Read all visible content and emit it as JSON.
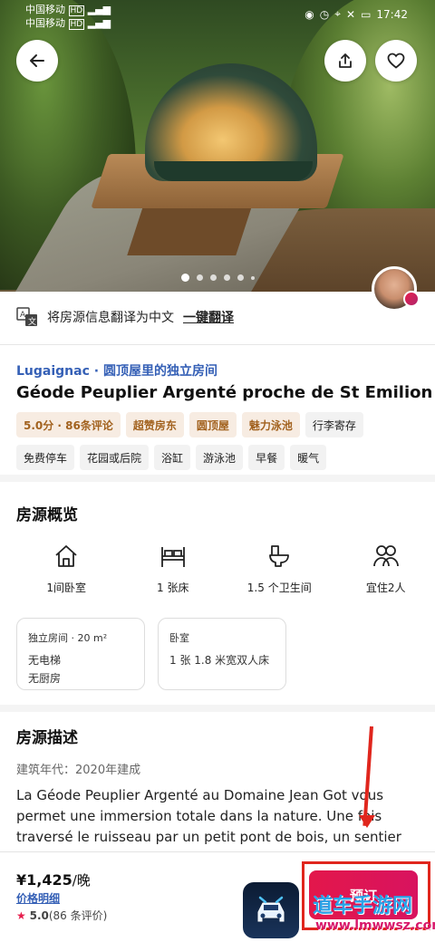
{
  "status_bar": {
    "carrier1": "中国移动",
    "carrier1_tag": "HD",
    "carrier2": "中国移动",
    "carrier2_tag": "HD",
    "time": "17:42"
  },
  "hero": {
    "slide_count": 5,
    "active_slide": 1
  },
  "translate": {
    "text": "将房源信息翻译为中文",
    "action": "一键翻译"
  },
  "listing": {
    "subtitle": "Lugaignac · 圆顶屋里的独立房间",
    "title": "Géode Peuplier Argenté proche de St Emilion",
    "tags": [
      {
        "label": "5.0分 · 86条评论",
        "highlight": true
      },
      {
        "label": "超赞房东",
        "highlight": true
      },
      {
        "label": "圆顶屋",
        "highlight": true
      },
      {
        "label": "魅力泳池",
        "highlight": true
      },
      {
        "label": "行李寄存",
        "highlight": false
      },
      {
        "label": "免费停车",
        "highlight": false
      },
      {
        "label": "花园或后院",
        "highlight": false
      },
      {
        "label": "浴缸",
        "highlight": false
      },
      {
        "label": "游泳池",
        "highlight": false
      },
      {
        "label": "早餐",
        "highlight": false
      },
      {
        "label": "暖气",
        "highlight": false
      }
    ]
  },
  "overview": {
    "title": "房源概览",
    "amenities": [
      {
        "label": "1间卧室",
        "icon": "house-icon"
      },
      {
        "label": "1 张床",
        "icon": "bed-icon"
      },
      {
        "label": "1.5 个卫生间",
        "icon": "toilet-icon"
      },
      {
        "label": "宜住2人",
        "icon": "people-icon"
      }
    ],
    "card1": {
      "head": "独立房间 · 20 m²",
      "line1": "无电梯",
      "line2": "无厨房"
    },
    "card2": {
      "head": "卧室",
      "line1": "1 张 1.8 米宽双人床"
    }
  },
  "description": {
    "title": "房源描述",
    "year": "建筑年代：2020年建成",
    "text": "La Géode Peuplier Argenté au Domaine Jean Got vous permet une immersion totale dans la nature. Une fois traversé le ruisseau par un petit pont de bois, un sentier dans le..."
  },
  "bottom_bar": {
    "price": "¥1,425",
    "price_unit": "/晚",
    "price_detail": "价格明细",
    "rating": "5.0",
    "reviews": "(86 条评价)",
    "book_label": "预订"
  },
  "watermark": {
    "text": "道车手游网",
    "url": "www.lmwwsz.com"
  },
  "colors": {
    "accent": "#e61e4d",
    "link": "#3560b6",
    "tag_highlight_bg": "#f7ece2",
    "tag_highlight_text": "#a2621f",
    "annotation_red": "#e0261d"
  }
}
